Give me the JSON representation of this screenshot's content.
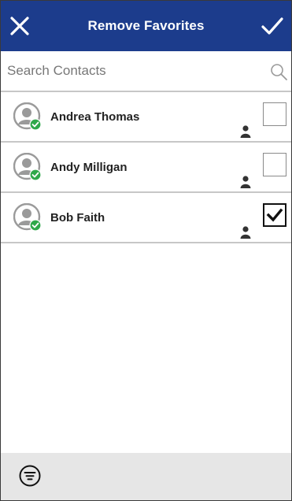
{
  "header": {
    "title": "Remove Favorites",
    "close_icon": "close-icon",
    "confirm_icon": "checkmark-icon",
    "background": "#1c3c8c"
  },
  "search": {
    "placeholder": "Search Contacts",
    "value": "",
    "icon": "search-icon"
  },
  "contacts": [
    {
      "name": "Andrea Thomas",
      "status": "available",
      "selected": false
    },
    {
      "name": "Andy Milligan",
      "status": "available",
      "selected": false
    },
    {
      "name": "Bob Faith",
      "status": "available",
      "selected": true
    }
  ],
  "footer": {
    "filter_icon": "filter-icon",
    "background": "#e6e6e6"
  },
  "colors": {
    "status_available": "#2ea84a",
    "avatar_gray": "#9a9a9a"
  }
}
